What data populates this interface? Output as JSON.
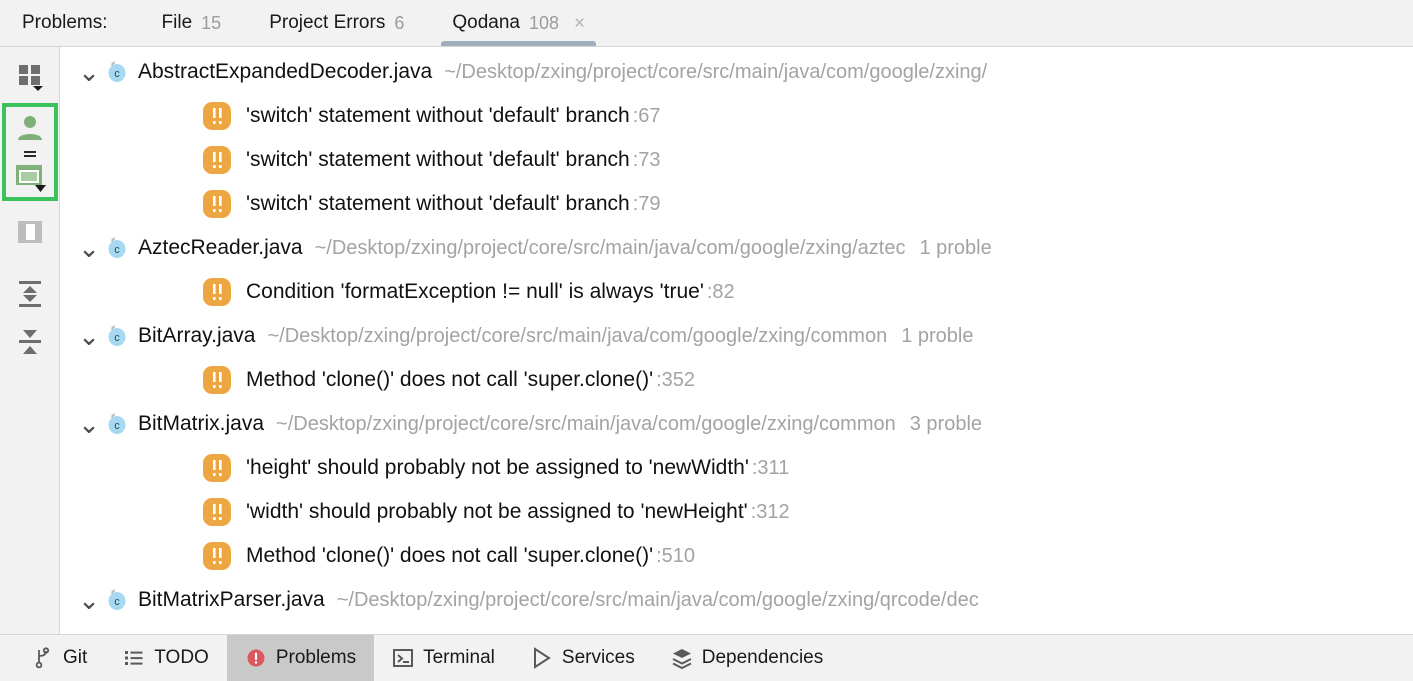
{
  "tabbar": {
    "title": "Problems:",
    "tabs": [
      {
        "label": "File",
        "count": "15",
        "selected": false,
        "closable": false
      },
      {
        "label": "Project Errors",
        "count": "6",
        "selected": false,
        "closable": false
      },
      {
        "label": "Qodana",
        "count": "108",
        "selected": true,
        "closable": true,
        "close_glyph": "×"
      }
    ]
  },
  "rail": {
    "items": [
      {
        "name": "grid-view-icon",
        "tooltip": "View Options"
      },
      {
        "name": "person-icon",
        "tooltip": "Group by Severity"
      },
      {
        "name": "preview-window-icon",
        "tooltip": "Open Editor Preview"
      },
      {
        "name": "split-panel-icon",
        "tooltip": "Toggle Preview"
      },
      {
        "name": "expand-all-icon",
        "tooltip": "Expand All"
      },
      {
        "name": "collapse-all-icon",
        "tooltip": "Collapse All"
      }
    ],
    "highlight_color": "#3dc15c"
  },
  "tree": {
    "chevron_glyph": "⌄",
    "files": [
      {
        "name": "AbstractExpandedDecoder.java",
        "path": "~/Desktop/zxing/project/core/src/main/java/com/google/zxing/",
        "count": "",
        "problems": [
          {
            "text": "'switch' statement without 'default' branch",
            "line": ":67"
          },
          {
            "text": "'switch' statement without 'default' branch",
            "line": ":73"
          },
          {
            "text": "'switch' statement without 'default' branch",
            "line": ":79"
          }
        ]
      },
      {
        "name": "AztecReader.java",
        "path": "~/Desktop/zxing/project/core/src/main/java/com/google/zxing/aztec",
        "count": "1 proble",
        "problems": [
          {
            "text": "Condition 'formatException != null' is always 'true'",
            "line": ":82"
          }
        ]
      },
      {
        "name": "BitArray.java",
        "path": "~/Desktop/zxing/project/core/src/main/java/com/google/zxing/common",
        "count": "1 proble",
        "problems": [
          {
            "text": "Method 'clone()' does not call 'super.clone()'",
            "line": ":352"
          }
        ]
      },
      {
        "name": "BitMatrix.java",
        "path": "~/Desktop/zxing/project/core/src/main/java/com/google/zxing/common",
        "count": "3 proble",
        "problems": [
          {
            "text": "'height' should probably not be assigned to 'newWidth'",
            "line": ":311"
          },
          {
            "text": "'width' should probably not be assigned to 'newHeight'",
            "line": ":312"
          },
          {
            "text": "Method 'clone()' does not call 'super.clone()'",
            "line": ":510"
          }
        ]
      },
      {
        "name": "BitMatrixParser.java",
        "path": "~/Desktop/zxing/project/core/src/main/java/com/google/zxing/qrcode/dec",
        "count": "",
        "problems": []
      }
    ]
  },
  "bottombar": {
    "buttons": [
      {
        "label": "Git",
        "icon": "git-branch-icon",
        "active": false
      },
      {
        "label": "TODO",
        "icon": "todo-list-icon",
        "active": false
      },
      {
        "label": "Problems",
        "icon": "problems-error-icon",
        "active": true
      },
      {
        "label": "Terminal",
        "icon": "terminal-icon",
        "active": false
      },
      {
        "label": "Services",
        "icon": "services-play-icon",
        "active": false
      },
      {
        "label": "Dependencies",
        "icon": "dependencies-layers-icon",
        "active": false
      }
    ]
  },
  "colors": {
    "warning_orange": "#eda742",
    "class_icon_blue": "#a6d8ef",
    "problems_red": "#db5860",
    "selection_green": "#3dc15c",
    "tab_underline": "#a0aebc"
  }
}
